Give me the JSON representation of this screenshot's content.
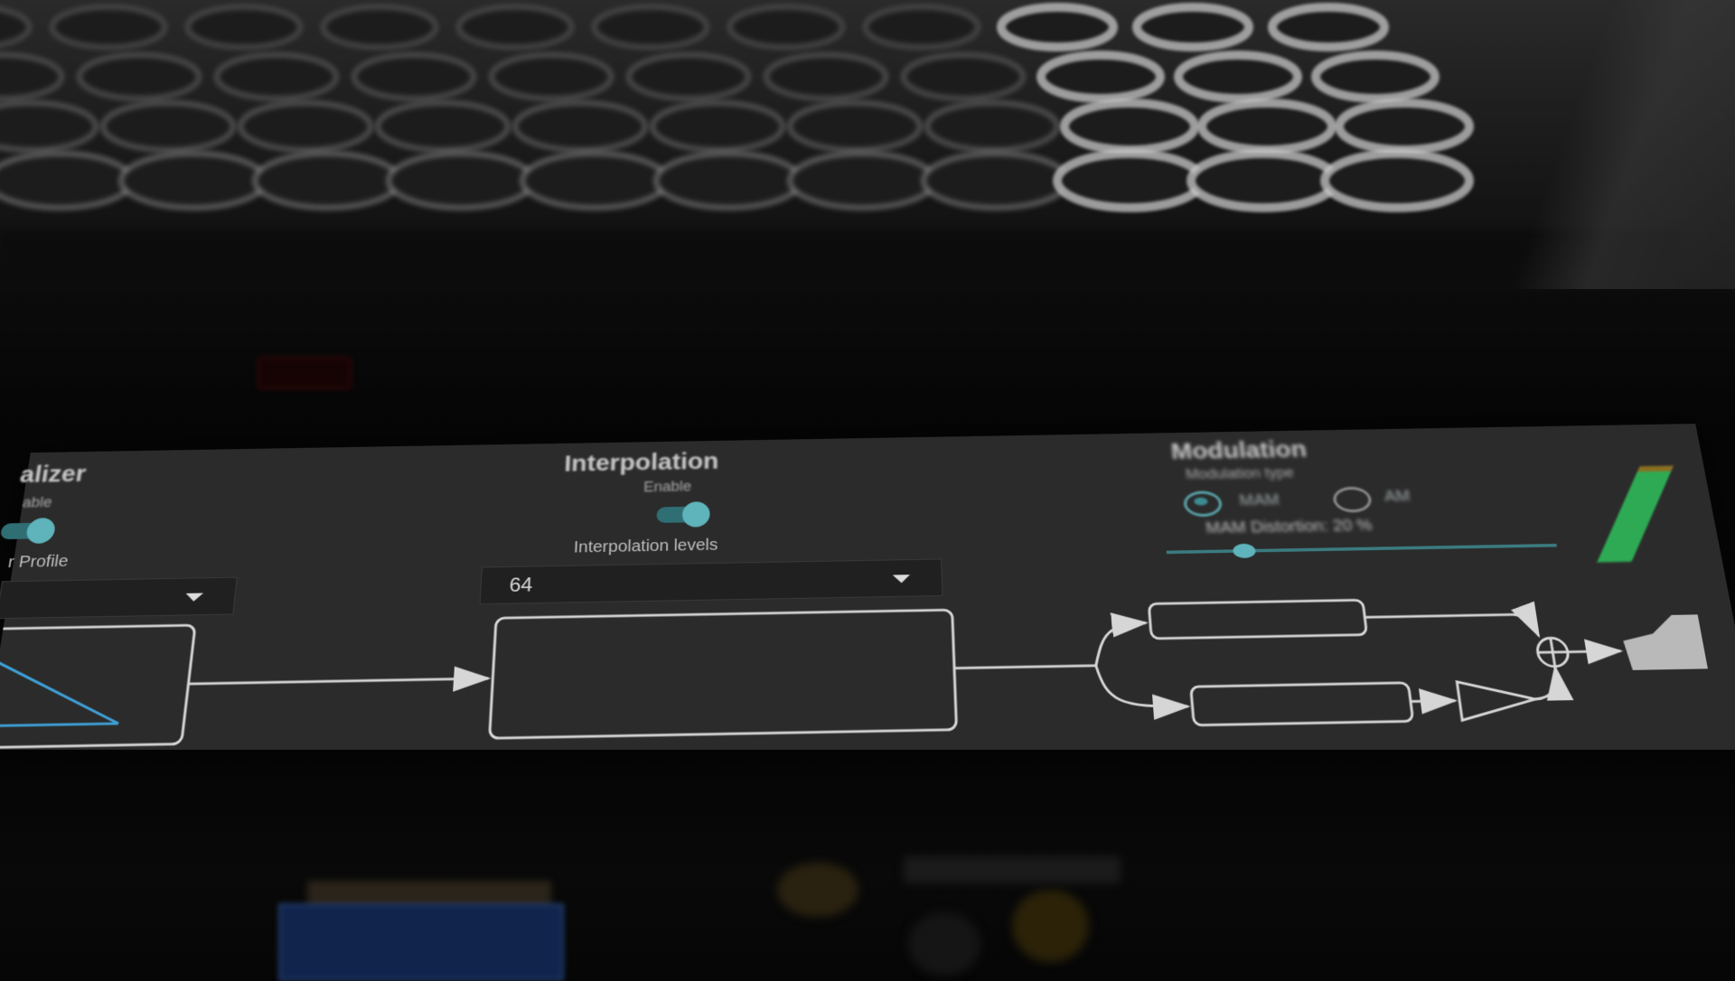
{
  "equalizer": {
    "title": "alizer",
    "enable_label": "able",
    "enabled": true,
    "profile_label": "r Profile",
    "profile_value": ""
  },
  "interpolation": {
    "title": "Interpolation",
    "enable_label": "Enable",
    "enabled": true,
    "levels_label": "Interpolation levels",
    "levels_value": "64"
  },
  "modulation": {
    "title": "Modulation",
    "type_label": "Modulation type",
    "option_1": "MAM",
    "option_2": "AM",
    "selected": "MAM",
    "distortion_label": "MAM Distortion: 20 %",
    "distortion_value": 0.2
  },
  "colors": {
    "accent": "#5fb3bb",
    "panel": "#2b2b2b",
    "meter_green": "#2eaa55",
    "meter_amber": "#8a6f22",
    "diagram_stroke": "#d6d6d6",
    "curve": "#3fa0d8"
  }
}
